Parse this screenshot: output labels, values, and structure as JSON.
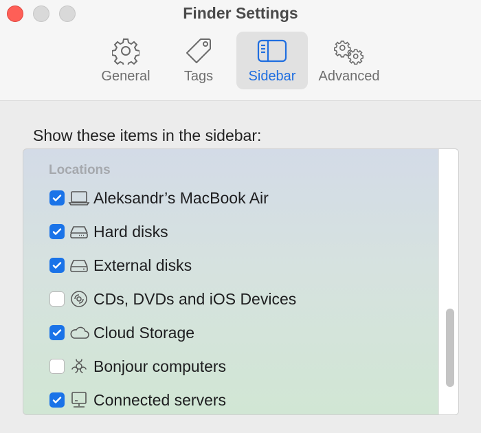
{
  "window": {
    "title": "Finder Settings",
    "controls": [
      "close",
      "minimize",
      "zoom"
    ]
  },
  "tabs": [
    {
      "label": "General",
      "icon": "gear-icon",
      "active": false
    },
    {
      "label": "Tags",
      "icon": "tag-icon",
      "active": false
    },
    {
      "label": "Sidebar",
      "icon": "sidebar-icon",
      "active": true
    },
    {
      "label": "Advanced",
      "icon": "gears-icon",
      "active": false
    }
  ],
  "content": {
    "heading": "Show these items in the sidebar:",
    "group_header": "Locations",
    "items": [
      {
        "label": "Aleksandr’s MacBook Air",
        "checked": true,
        "icon": "laptop-icon"
      },
      {
        "label": "Hard disks",
        "checked": true,
        "icon": "internal-disk-icon"
      },
      {
        "label": "External disks",
        "checked": true,
        "icon": "external-disk-icon"
      },
      {
        "label": "CDs, DVDs and iOS Devices",
        "checked": false,
        "icon": "disc-icon"
      },
      {
        "label": "Cloud Storage",
        "checked": true,
        "icon": "cloud-icon"
      },
      {
        "label": "Bonjour computers",
        "checked": false,
        "icon": "bonjour-icon"
      },
      {
        "label": "Connected servers",
        "checked": true,
        "icon": "server-icon"
      }
    ]
  },
  "colors": {
    "accent": "#1a73e8",
    "active_tab_text": "#1f6ee0",
    "close_button": "#fe5f57"
  }
}
